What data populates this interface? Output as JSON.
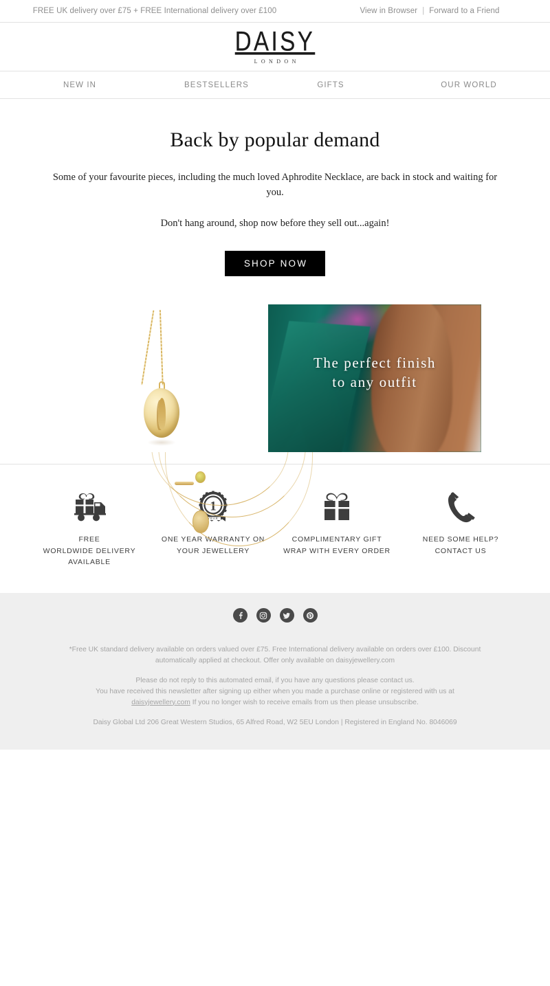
{
  "preheader": {
    "promo": "FREE UK delivery over £75 + FREE International delivery over £100",
    "view_in_browser": "View in Browser",
    "separator": "|",
    "forward_to_friend": "Forward to a Friend"
  },
  "brand": {
    "name": "DAISY",
    "location": "LONDON"
  },
  "nav": {
    "items": [
      {
        "label": "NEW IN"
      },
      {
        "label": "BESTSELLERS"
      },
      {
        "label": "GIFTS"
      },
      {
        "label": "OUR WORLD"
      }
    ]
  },
  "hero": {
    "headline": "Back by popular demand",
    "paragraph_1": "Some of your favourite pieces, including the much loved Aphrodite Necklace, are back in stock and waiting for you.",
    "paragraph_2": "Don't hang around, shop now before they sell out...again!",
    "cta_label": "SHOP NOW"
  },
  "images": {
    "hero_alt": "Model wearing layered gold necklaces with Aphrodite pendant",
    "product_alt": "Aphrodite gold pendant necklace on white background",
    "lifestyle_alt": "Model in green outfit close-up",
    "lifestyle_overlay_line_1": "The perfect finish",
    "lifestyle_overlay_line_2": "to any outfit"
  },
  "usp": {
    "items": [
      {
        "icon": "delivery-truck-icon",
        "label": "FREE\nWORLDWIDE DELIVERY\nAVAILABLE"
      },
      {
        "icon": "warranty-badge-icon",
        "label": "ONE YEAR WARRANTY ON\nYOUR JEWELLERY"
      },
      {
        "icon": "gift-box-icon",
        "label": "COMPLIMENTARY GIFT\nWRAP WITH EVERY ORDER"
      },
      {
        "icon": "telephone-icon",
        "label": "NEED SOME HELP?\nCONTACT US"
      }
    ]
  },
  "footer": {
    "social": [
      {
        "name": "facebook-icon",
        "glyph": "f"
      },
      {
        "name": "instagram-icon",
        "glyph": ""
      },
      {
        "name": "twitter-icon",
        "glyph": ""
      },
      {
        "name": "pinterest-icon",
        "glyph": ""
      }
    ],
    "disclaimer": "*Free UK standard delivery available on orders valued over £75. Free International delivery available on orders over £100. Discount automatically applied at checkout. Offer only available on daisyjewellery.com",
    "notice_line_1": "Please do not reply to this automated email, if you have any questions please contact us.",
    "notice_line_2": "You have received this newsletter after signing up either when you made a purchase online or registered with us at ",
    "notice_link": "daisyjewellery.com",
    "notice_line_3": " If you no longer wish to receive emails from us then please unsubscribe.",
    "company": "Daisy Global Ltd 206 Great Western Studios, 65 Alfred Road, W2 5EU London | Registered in England No. 8046069"
  },
  "colors": {
    "accent": "#000000",
    "footer_bg": "#efefef",
    "muted_text": "#a5a5a5",
    "divider": "#e2e2e2"
  }
}
